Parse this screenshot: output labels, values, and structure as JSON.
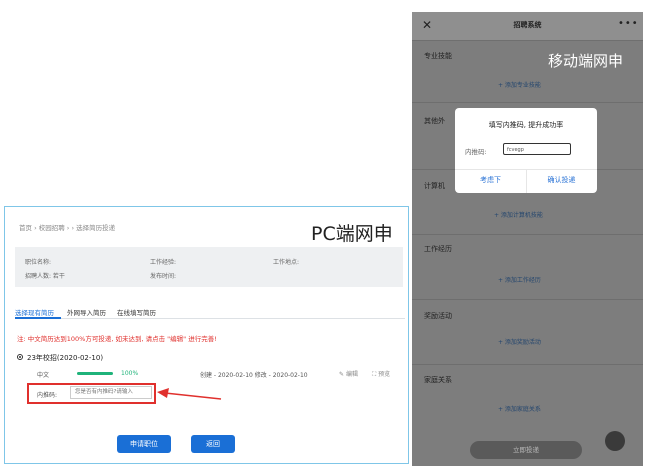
{
  "pc": {
    "breadcrumb": "首页 › 校园招聘 › › 选择简历投递",
    "label": "PC端网申",
    "info": {
      "position_name": "职位名称:",
      "hire_count": "招聘人数: 若干",
      "work_experience": "工作经验:",
      "publish_time": "发布时间:",
      "work_location": "工作地点:"
    },
    "tabs": [
      "选择现有简历",
      "外网导入简历",
      "在线填写简历"
    ],
    "warning": "注: 中文简历达到100%方可投递, 如未达到, 请点击 \"编辑\" 进行完善!",
    "resume": {
      "name": "23年校招(2020-02-10)",
      "language": "中文",
      "progress_percent": 100,
      "progress_text": "100%",
      "dates": "创建 - 2020-02-10    修改 - 2020-02-10",
      "edit": "编辑",
      "preview": "预览"
    },
    "referral": {
      "label": "内推码:",
      "placeholder": "您是否有内推码?请输入"
    },
    "buttons": {
      "apply": "申请职位",
      "back": "返回"
    },
    "accent_color": "#1a6fd6",
    "warning_color": "#e0302d",
    "progress_color": "#1fb37a"
  },
  "mobile": {
    "title": "招聘系统",
    "close_icon": "close-icon",
    "more_icon": "more-icon",
    "label": "移动端网申",
    "sections": [
      {
        "title": "专业技能",
        "add": "+ 添加专业技能"
      },
      {
        "title": "其他外",
        "add": ""
      },
      {
        "title": "计算机",
        "add": "+ 添加计算机技能"
      },
      {
        "title": "工作经历",
        "add": "+ 添加工作经历"
      },
      {
        "title": "奖励活动",
        "add": "+ 添加奖励活动"
      },
      {
        "title": "家庭关系",
        "add": "+ 添加家庭关系"
      }
    ],
    "dialog": {
      "title": "填写内推码, 提升成功率",
      "label": "内推码:",
      "value": "fcvegp",
      "cancel": "考虑下",
      "confirm": "确认投递"
    },
    "submit": "立即投递"
  }
}
